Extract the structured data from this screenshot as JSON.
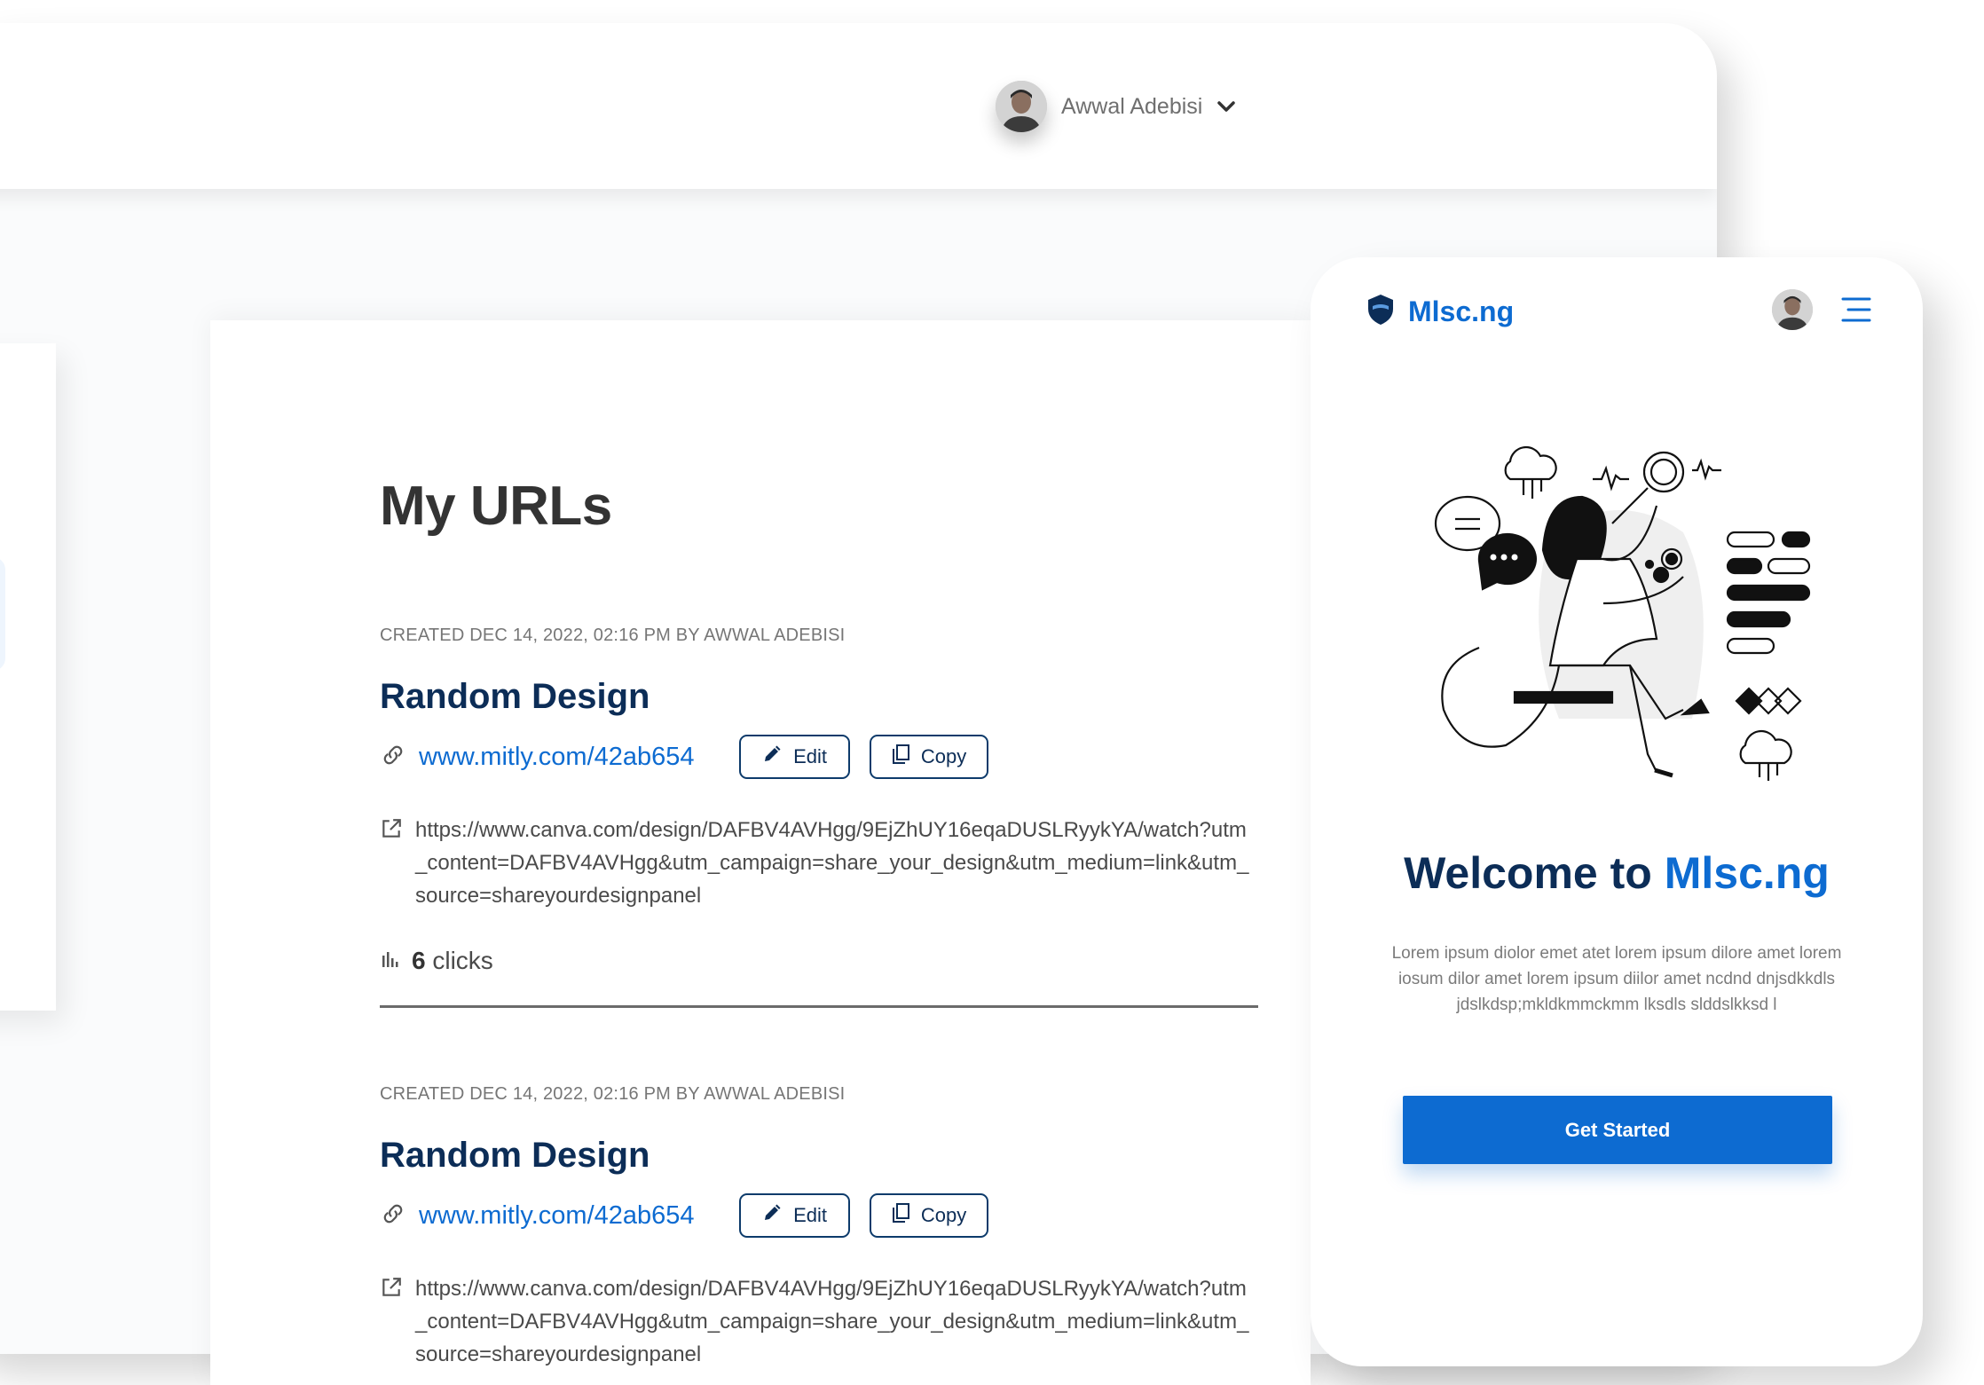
{
  "header": {
    "user_name": "Awwal Adebisi"
  },
  "main": {
    "title": "My URLs",
    "entries": [
      {
        "meta": "CREATED DEC 14, 2022, 02:16 PM BY AWWAL ADEBISI",
        "title": "Random Design",
        "short_url": "www.mitly.com/42ab654",
        "edit_label": "Edit",
        "copy_label": "Copy",
        "long_url": "https://www.canva.com/design/DAFBV4AVHgg/9EjZhUY16eqaDUSLRyykYA/watch?utm_content=DAFBV4AVHgg&utm_campaign=share_your_design&utm_medium=link&utm_source=shareyourdesignpanel",
        "clicks_count": "6",
        "clicks_label": "clicks"
      },
      {
        "meta": "CREATED DEC 14, 2022, 02:16 PM BY AWWAL ADEBISI",
        "title": "Random Design",
        "short_url": "www.mitly.com/42ab654",
        "edit_label": "Edit",
        "copy_label": "Copy",
        "long_url": "https://www.canva.com/design/DAFBV4AVHgg/9EjZhUY16eqaDUSLRyykYA/watch?utm_content=DAFBV4AVHgg&utm_campaign=share_your_design&utm_medium=link&utm_source=shareyourdesignpanel"
      }
    ]
  },
  "mobile": {
    "brand": "Mlsc.ng",
    "welcome_prefix": "Welcome to",
    "welcome_brand": "Mlsc.ng",
    "description": "Lorem ipsum diolor emet atet lorem ipsum dilore amet lorem iosum dilor amet lorem ipsum diilor amet ncdnd dnjsdkkdls jdslkdsp;mkldkmmckmm lksdls slddslkksd l",
    "cta_label": "Get Started"
  },
  "colors": {
    "primary": "#0d6bd1",
    "navy": "#0c2d57",
    "text_gray": "#767676"
  },
  "icons": [
    "chevron-down-icon",
    "link-icon",
    "pencil-icon",
    "copy-icon",
    "external-link-icon",
    "bar-chart-icon",
    "shield-logo-icon",
    "hamburger-menu-icon"
  ]
}
